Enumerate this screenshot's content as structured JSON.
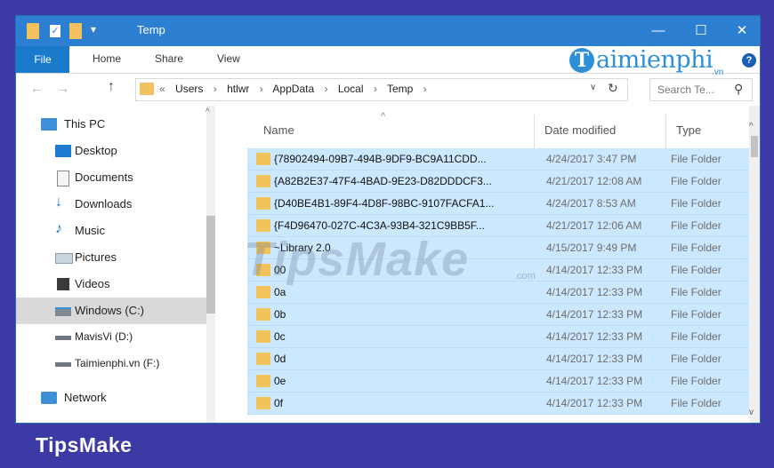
{
  "window": {
    "title": "Temp"
  },
  "ribbon": {
    "tabs": [
      "File",
      "Home",
      "Share",
      "View"
    ]
  },
  "logo": {
    "text": "aimienphi",
    "letter": "T",
    "sub": ".vn"
  },
  "help": {
    "label": "?"
  },
  "address": {
    "crumbs": [
      "«",
      "Users",
      "›",
      "htlwr",
      "›",
      "AppData",
      "›",
      "Local",
      "›",
      "Temp",
      "›"
    ],
    "search_placeholder": "Search Te..."
  },
  "sidebar": {
    "items": [
      {
        "label": "This PC",
        "icon": "computer-icon"
      },
      {
        "label": "Desktop",
        "icon": "desktop-icon"
      },
      {
        "label": "Documents",
        "icon": "documents-icon"
      },
      {
        "label": "Downloads",
        "icon": "download-icon"
      },
      {
        "label": "Music",
        "icon": "music-icon"
      },
      {
        "label": "Pictures",
        "icon": "pictures-icon"
      },
      {
        "label": "Videos",
        "icon": "videos-icon"
      },
      {
        "label": "Windows (C:)",
        "icon": "drive-icon"
      },
      {
        "label": "MavisVi (D:)",
        "icon": "drive-icon"
      },
      {
        "label": "Taimienphi.vn (F:)",
        "icon": "drive-icon"
      },
      {
        "label": "Network",
        "icon": "network-icon"
      }
    ],
    "selected_index": 7
  },
  "columns": {
    "name": "Name",
    "date": "Date modified",
    "type": "Type"
  },
  "files": [
    {
      "name": "{78902494-09B7-494B-9DF9-BC9A11CDD...",
      "date": "4/24/2017 3:47 PM",
      "type": "File Folder"
    },
    {
      "name": "{A82B2E37-47F4-4BAD-9E23-D82DDDCF3...",
      "date": "4/21/2017 12:08 AM",
      "type": "File Folder"
    },
    {
      "name": "{D40BE4B1-89F4-4D8F-98BC-9107FACFA1...",
      "date": "4/24/2017 8:53 AM",
      "type": "File Folder"
    },
    {
      "name": "{F4D96470-027C-4C3A-93B4-321C9BB5F...",
      "date": "4/21/2017 12:06 AM",
      "type": "File Folder"
    },
    {
      "name": "~Library 2.0",
      "date": "4/15/2017 9:49 PM",
      "type": "File Folder"
    },
    {
      "name": "00",
      "date": "4/14/2017 12:33 PM",
      "type": "File Folder"
    },
    {
      "name": "0a",
      "date": "4/14/2017 12:33 PM",
      "type": "File Folder"
    },
    {
      "name": "0b",
      "date": "4/14/2017 12:33 PM",
      "type": "File Folder"
    },
    {
      "name": "0c",
      "date": "4/14/2017 12:33 PM",
      "type": "File Folder"
    },
    {
      "name": "0d",
      "date": "4/14/2017 12:33 PM",
      "type": "File Folder"
    },
    {
      "name": "0e",
      "date": "4/14/2017 12:33 PM",
      "type": "File Folder"
    },
    {
      "name": "0f",
      "date": "4/14/2017 12:33 PM",
      "type": "File Folder"
    }
  ],
  "watermark": {
    "text": "TipsMake",
    "suffix": ".com"
  },
  "footer": {
    "brand": "TipsMake"
  },
  "colors": {
    "titlebar": "#2c7fd1",
    "selection": "#cce8ff",
    "background": "#3d3aa6"
  }
}
